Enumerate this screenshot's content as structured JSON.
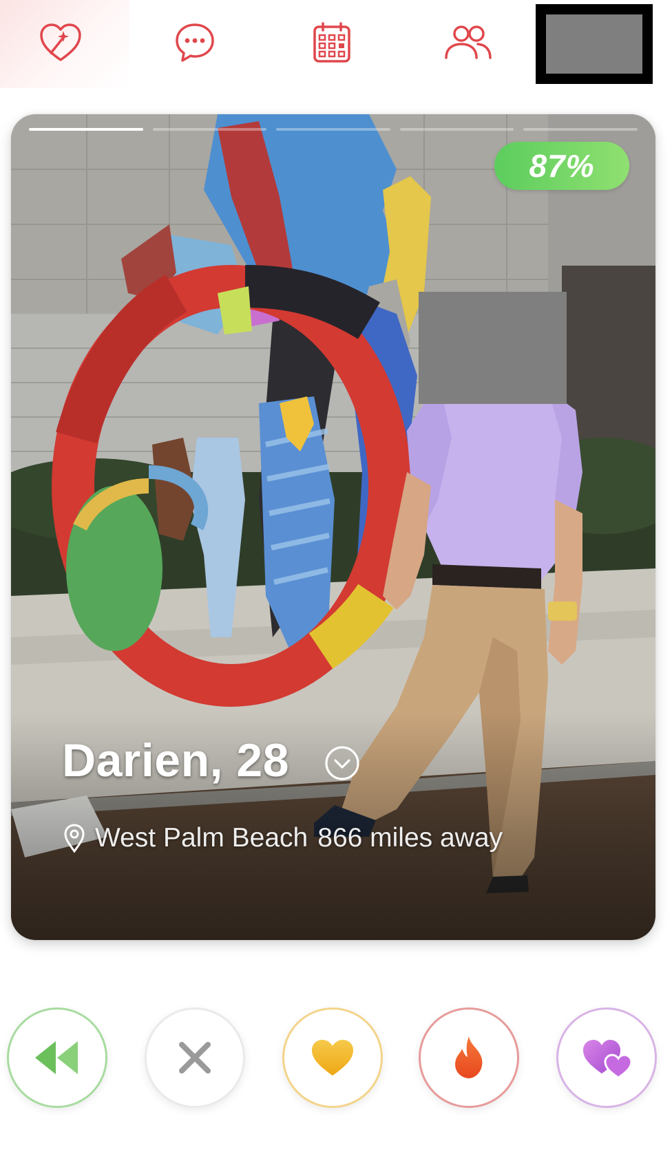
{
  "nav": {
    "items": [
      {
        "name": "matchmaker",
        "icon": "heart-wand-icon",
        "active": true
      },
      {
        "name": "messages",
        "icon": "chat-bubble-icon",
        "active": false
      },
      {
        "name": "events",
        "icon": "calendar-icon",
        "active": false
      },
      {
        "name": "friends",
        "icon": "people-icon",
        "active": false
      }
    ],
    "accent_color": "#e0474c"
  },
  "profile": {
    "name_age": "Darien, 28",
    "location": "West Palm Beach",
    "distance": "866 miles away",
    "match_percent": "87%",
    "photo_count": 5,
    "current_photo": 1
  },
  "actions": [
    {
      "name": "rewind",
      "icon": "rewind-icon",
      "color": "#6cc05c"
    },
    {
      "name": "nope",
      "icon": "close-icon",
      "color": "#9a9a9a"
    },
    {
      "name": "super-like",
      "icon": "heart-icon",
      "color": "#f1b21c"
    },
    {
      "name": "boost",
      "icon": "flame-icon",
      "color": "#f0542a"
    },
    {
      "name": "like",
      "icon": "double-heart-icon",
      "color": "#b45ad6"
    }
  ]
}
